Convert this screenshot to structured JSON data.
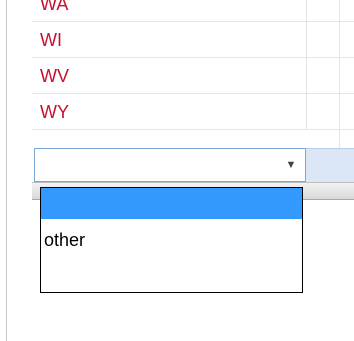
{
  "grid": {
    "rows": [
      {
        "value": "WA"
      },
      {
        "value": "WI"
      },
      {
        "value": "WV"
      },
      {
        "value": "WY"
      }
    ]
  },
  "combo": {
    "value": "",
    "arrow_icon": "dropdown-arrow-icon"
  },
  "dropdown": {
    "options": [
      {
        "label": "",
        "selected": true
      },
      {
        "label": "other",
        "selected": false
      }
    ]
  },
  "colors": {
    "state_text": "#c8102e",
    "selection": "#3399ff",
    "combo_border": "#7aa7d6"
  }
}
